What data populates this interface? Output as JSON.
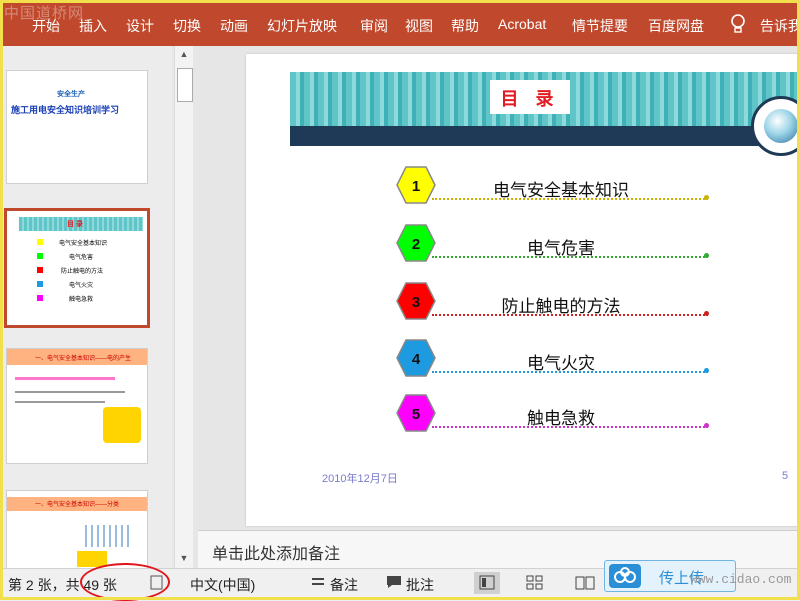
{
  "watermark": "中国道桥网",
  "ribbon": {
    "tabs": [
      "开始",
      "插入",
      "设计",
      "切换",
      "动画",
      "幻灯片放映",
      "审阅",
      "视图",
      "帮助",
      "Acrobat",
      "情节提要",
      "百度网盘",
      "告诉我"
    ]
  },
  "thumbnails": [
    {
      "title": "施工用电安全知识培训学习",
      "small": "安全生产"
    },
    {
      "title": "目 录",
      "items": [
        "电气安全基本知识",
        "电气危害",
        "防止触电的方法",
        "电气火灾",
        "触电急救"
      ],
      "selected": true
    },
    {
      "title": "一、电气安全基本知识——电的产生"
    },
    {
      "title": "一、电气安全基本知识——分类"
    }
  ],
  "slide": {
    "title": "目 录",
    "items": [
      {
        "number": "1",
        "label": "电气安全基本知识",
        "color": "#ffff00",
        "line_color": "#c8b400"
      },
      {
        "number": "2",
        "label": "电气危害",
        "color": "#00ff00",
        "line_color": "#33aa33"
      },
      {
        "number": "3",
        "label": "防止触电的方法",
        "color": "#ff0000",
        "line_color": "#cc2222"
      },
      {
        "number": "4",
        "label": "电气火灾",
        "color": "#1e9be0",
        "line_color": "#1e9be0"
      },
      {
        "number": "5",
        "label": "触电急救",
        "color": "#ff00ff",
        "line_color": "#cc33cc"
      }
    ],
    "date": "2010年12月7日",
    "page_number": "5"
  },
  "notes_placeholder": "单击此处添加备注",
  "status_bar": {
    "slide_info": "第 2 张，共 49 张",
    "language": "中文(中国)",
    "notes_label": "备注",
    "comments_label": "批注",
    "upload_label": "传上传",
    "site_watermark": "www.cidao.com"
  },
  "colors": {
    "ribbon": "#c0492d",
    "accent_red": "#e31b22",
    "annotation": "#e0161b"
  }
}
